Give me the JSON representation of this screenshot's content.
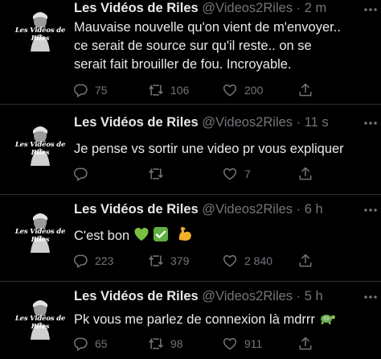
{
  "avatar_label": "Les Vidéos de Riles",
  "tweets": [
    {
      "name": "Les Vidéos de Riles",
      "handle": "@Videos2Riles",
      "separator": "·",
      "time": "2 m",
      "text_lines": [
        "Mauvaise nouvelle qu'on vient de m'envoyer..",
        "ce serait de source sur qu'il reste.. on se",
        "serait fait brouiller de fou. Incroyable."
      ],
      "replies": "75",
      "retweets": "106",
      "likes": "200"
    },
    {
      "name": "Les Vidéos de Riles",
      "handle": "@Videos2Riles",
      "separator": "·",
      "time": "11 s",
      "text_lines": [
        "Je pense vs sortir une video pr vous expliquer"
      ],
      "replies": "",
      "retweets": "",
      "likes": "7"
    },
    {
      "name": "Les Vidéos de Riles",
      "handle": "@Videos2Riles",
      "separator": "·",
      "time": "6 h",
      "text_lines": [
        "C'est bon"
      ],
      "emojis": [
        "green-heart",
        "check-mark-button",
        "flexed-biceps"
      ],
      "replies": "223",
      "retweets": "379",
      "likes": "2 840"
    },
    {
      "name": "Les Vidéos de Riles",
      "handle": "@Videos2Riles",
      "separator": "·",
      "time": "5 h",
      "text_lines": [
        "Pk vous me parlez de connexion là mdrrr"
      ],
      "emojis": [
        "turtle"
      ],
      "replies": "65",
      "retweets": "98",
      "likes": "911"
    }
  ],
  "colors": {
    "background": "#000000",
    "text": "#e7e9ea",
    "secondary": "#71767b",
    "divider": "#2f3336"
  }
}
